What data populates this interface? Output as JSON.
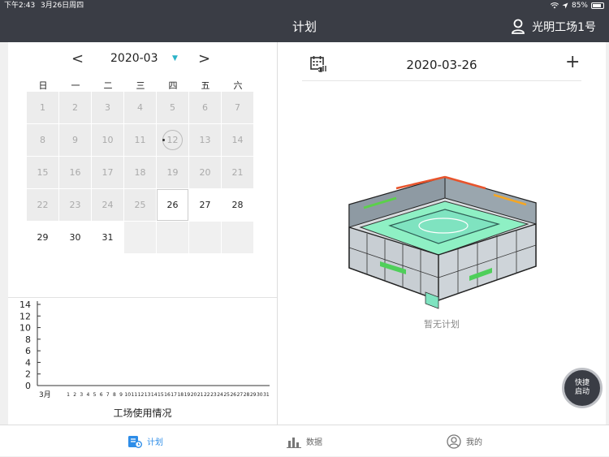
{
  "status_bar": {
    "time": "下午2:43",
    "date": "3月26日周四",
    "battery": "85%",
    "battery_level": 0.85
  },
  "header": {
    "title": "计划",
    "factory_name": "光明工场1号"
  },
  "calendar": {
    "month_label": "2020-03",
    "prev_symbol": "<",
    "next_symbol": ">",
    "caret_symbol": "▼",
    "weekdays": [
      "日",
      "一",
      "二",
      "三",
      "四",
      "五",
      "六"
    ],
    "days": [
      "1",
      "2",
      "3",
      "4",
      "5",
      "6",
      "7",
      "8",
      "9",
      "10",
      "11",
      "12",
      "13",
      "14",
      "15",
      "16",
      "17",
      "18",
      "19",
      "20",
      "21",
      "22",
      "23",
      "24",
      "25",
      "26",
      "27",
      "28",
      "29",
      "30",
      "31"
    ],
    "today": "26",
    "marked_day": "12"
  },
  "chart_data": {
    "type": "bar",
    "title": "工场使用情况",
    "x_prefix": "3月",
    "categories": [
      "1",
      "2",
      "3",
      "4",
      "5",
      "6",
      "7",
      "8",
      "9",
      "10",
      "11",
      "12",
      "13",
      "14",
      "15",
      "16",
      "17",
      "18",
      "19",
      "20",
      "21",
      "22",
      "23",
      "24",
      "25",
      "26",
      "27",
      "28",
      "29",
      "30",
      "31"
    ],
    "values": [
      0,
      0,
      0,
      0,
      0,
      0,
      0,
      0,
      0,
      0,
      0,
      0,
      0,
      0,
      0,
      0,
      0,
      0,
      0,
      0,
      0,
      0,
      0,
      0,
      0,
      0,
      0,
      0,
      0,
      0,
      0
    ],
    "yticks": [
      "0",
      "2",
      "4",
      "6",
      "8",
      "10",
      "12",
      "14"
    ],
    "ylim": [
      0,
      14
    ]
  },
  "detail": {
    "date": "2020-03-26",
    "add_symbol": "+",
    "empty_text": "暂无计划"
  },
  "fab": {
    "line1": "快捷",
    "line2": "启动"
  },
  "tabs": {
    "plan": "计划",
    "data": "数据",
    "mine": "我的"
  },
  "colors": {
    "header_bg": "#3a3d45",
    "active_tab": "#2e8de8",
    "accent_caret": "#2bb3c8"
  }
}
